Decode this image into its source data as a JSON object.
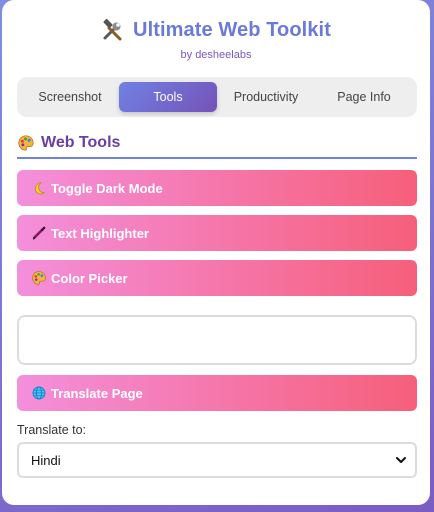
{
  "header": {
    "icon": "hammer-and-wrench-icon",
    "title": "Ultimate Web Toolkit",
    "subtitle": "by desheelabs"
  },
  "tabs": [
    {
      "label": "Screenshot",
      "active": false
    },
    {
      "label": "Tools",
      "active": true
    },
    {
      "label": "Productivity",
      "active": false
    },
    {
      "label": "Page Info",
      "active": false
    }
  ],
  "section": {
    "icon": "palette-icon",
    "title": "Web Tools"
  },
  "tools": {
    "dark_mode": {
      "icon": "crescent-moon-icon",
      "label": "Toggle Dark Mode"
    },
    "highlighter": {
      "icon": "pen-icon",
      "label": "Text Highlighter"
    },
    "color_picker": {
      "icon": "palette-icon",
      "label": "Color Picker"
    },
    "translate": {
      "icon": "globe-icon",
      "label": "Translate Page"
    }
  },
  "color_output": {
    "value": ""
  },
  "translate": {
    "label": "Translate to:",
    "selected": "Hindi"
  },
  "colors": {
    "accent": "#6a7ad8",
    "purple": "#6b3fa0",
    "button_gradient_start": "#f48fdc",
    "button_gradient_end": "#f65f7a"
  }
}
